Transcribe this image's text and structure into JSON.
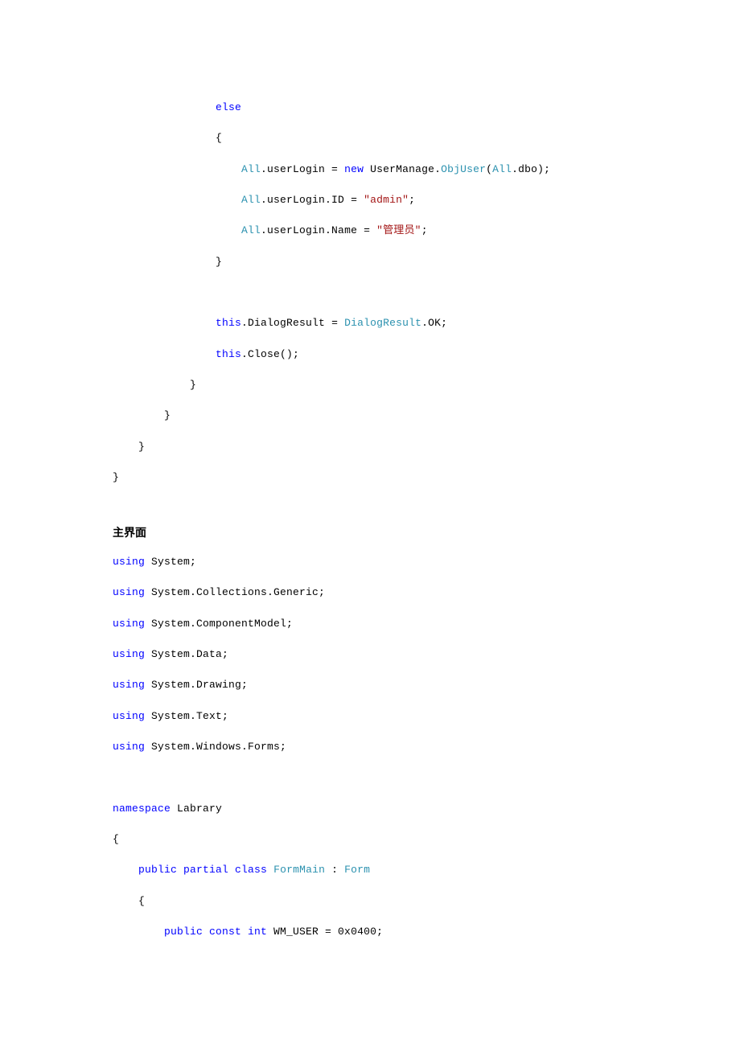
{
  "code1": {
    "l1_else": "else",
    "l2_brace": "{",
    "l3_all": "All",
    "l3_a": ".userLogin = ",
    "l3_new": "new",
    "l3_b": " UserManage.",
    "l3_obj": "ObjUser",
    "l3_c": "(",
    "l3_all2": "All",
    "l3_d": ".dbo);",
    "l4_all": "All",
    "l4_a": ".userLogin.ID = ",
    "l4_str": "\"admin\"",
    "l4_b": ";",
    "l5_all": "All",
    "l5_a": ".userLogin.Name = ",
    "l5_str": "\"管理员\"",
    "l5_b": ";",
    "l6_brace": "}",
    "l7_this": "this",
    "l7_a": ".DialogResult = ",
    "l7_dr": "DialogResult",
    "l7_b": ".OK;",
    "l8_this": "this",
    "l8_a": ".Close();",
    "l9_brace": "}",
    "l10_brace": "}",
    "l11_brace": "}",
    "l12_brace": "}"
  },
  "heading": "主界面",
  "code2": {
    "u1a": "using",
    "u1b": " System;",
    "u2a": "using",
    "u2b": " System.Collections.Generic;",
    "u3a": "using",
    "u3b": " System.ComponentModel;",
    "u4a": "using",
    "u4b": " System.Data;",
    "u5a": "using",
    "u5b": " System.Drawing;",
    "u6a": "using",
    "u6b": " System.Text;",
    "u7a": "using",
    "u7b": " System.Windows.Forms;",
    "ns_a": "namespace",
    "ns_b": " Labrary",
    "brace_open": "{",
    "cls_a": "public partial class",
    "cls_b": "FormMain",
    "cls_c": " : ",
    "cls_d": "Form",
    "cls_brace": "{",
    "const_a": "public const int",
    "const_b": " WM_USER = 0x0400;"
  }
}
